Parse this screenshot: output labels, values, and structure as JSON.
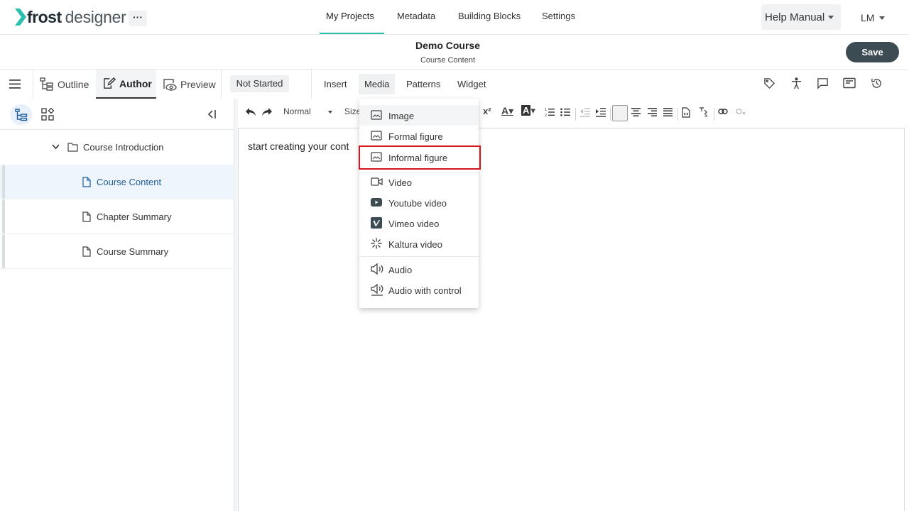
{
  "brand": {
    "name_bold": "frost",
    "name_light": "designer",
    "accent": "#2cbfb0"
  },
  "topnav": {
    "more_label": "···",
    "items": [
      {
        "label": "My Projects",
        "active": true
      },
      {
        "label": "Metadata"
      },
      {
        "label": "Building Blocks"
      },
      {
        "label": "Settings"
      }
    ],
    "help_label": "Help Manual",
    "user_initials": "LM"
  },
  "titlebar": {
    "title": "Demo Course",
    "subtitle": "Course Content",
    "save_label": "Save",
    "save_color": "#3d4c53"
  },
  "modebar": {
    "tabs": [
      {
        "label": "Outline",
        "icon": "outline-tree-icon"
      },
      {
        "label": "Author",
        "icon": "author-edit-icon",
        "active": true
      },
      {
        "label": "Preview",
        "icon": "preview-eye-icon"
      }
    ],
    "status": "Not Started",
    "menu": [
      {
        "label": "Insert"
      },
      {
        "label": "Media",
        "active": true
      },
      {
        "label": "Patterns"
      },
      {
        "label": "Widget"
      }
    ],
    "right_icons": [
      "tag-icon",
      "accessibility-icon",
      "comment-icon",
      "notes-icon",
      "history-icon"
    ]
  },
  "tree": {
    "root": {
      "label": "Course Introduction",
      "icon": "folder-icon"
    },
    "items": [
      {
        "label": "Course Content",
        "icon": "page-icon",
        "active": true
      },
      {
        "label": "Chapter Summary",
        "icon": "page-icon"
      },
      {
        "label": "Course Summary",
        "icon": "page-icon"
      }
    ]
  },
  "editor": {
    "format_select": "Normal",
    "size_select": "Size",
    "placeholder_text": "start creating your cont"
  },
  "media_menu": {
    "items": [
      {
        "label": "Image",
        "icon": "image-icon",
        "hover": true
      },
      {
        "label": "Formal figure",
        "icon": "image-icon"
      },
      {
        "label": "Informal figure",
        "icon": "image-icon",
        "highlighted": true
      },
      {
        "label": "Video",
        "icon": "video-icon"
      },
      {
        "label": "Youtube video",
        "icon": "youtube-icon"
      },
      {
        "label": "Vimeo video",
        "icon": "vimeo-icon"
      },
      {
        "label": "Kaltura video",
        "icon": "kaltura-icon"
      },
      {
        "label": "Audio",
        "icon": "audio-icon"
      },
      {
        "label": "Audio with control",
        "icon": "audio-control-icon"
      }
    ],
    "highlight_color": "#d8141c"
  }
}
